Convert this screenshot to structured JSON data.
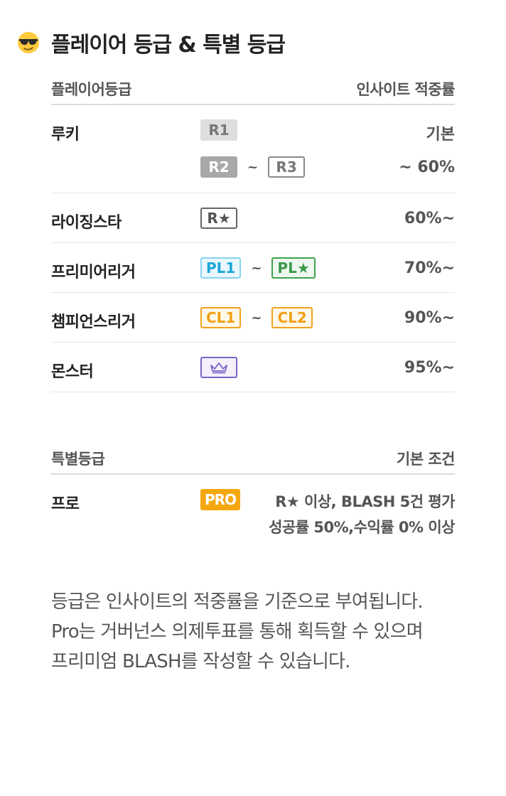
{
  "header": {
    "icon": "sunglasses-emoji-icon",
    "title": "플레이어 등급 & 특별 등급"
  },
  "player_grades": {
    "col_left": "플레이어등급",
    "col_right": "인사이트 적중률",
    "rows": [
      {
        "name": "루키",
        "badge1": "R1",
        "value1": "기본",
        "badge2a": "R2",
        "tilde": "~",
        "badge2b": "R3",
        "value2": "~ 60%"
      },
      {
        "name": "라이징스타",
        "badge": "R★",
        "value": "60%~"
      },
      {
        "name": "프리미어리거",
        "badge_a": "PL1",
        "tilde": "~",
        "badge_b": "PL★",
        "value": "70%~"
      },
      {
        "name": "챔피언스리거",
        "badge_a": "CL1",
        "tilde": "~",
        "badge_b": "CL2",
        "value": "90%~"
      },
      {
        "name": "몬스터",
        "badge_icon": "crown-icon",
        "value": "95%~"
      }
    ]
  },
  "special_grades": {
    "col_left": "특별등급",
    "col_right": "기본 조건",
    "rows": [
      {
        "name": "프로",
        "badge": "PRO",
        "condition_line1": "R★ 이상, BLASH 5건 평가",
        "condition_line2": "성공률 50%,수익률 0% 이상"
      }
    ]
  },
  "note": {
    "line1": "등급은 인사이트의 적중률을 기준으로 부여됩니다.",
    "line2": "Pro는 거버넌스 의제투표를 통해 획득할 수 있으며",
    "line3": "프리미엄 BLASH를 작성할 수 있습니다."
  },
  "colors": {
    "orange": "#f5a70f",
    "blue": "#1ba6d8",
    "green": "#3b9a4c",
    "purple": "#7a63c6",
    "gray": "#a8a8a8"
  }
}
